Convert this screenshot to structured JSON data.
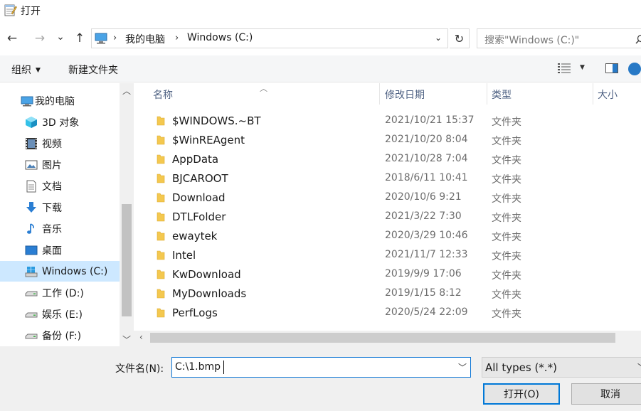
{
  "window": {
    "title": "打开"
  },
  "nav_buttons": {
    "back": "←",
    "forward": "→",
    "recent": "⌄",
    "up": "↑"
  },
  "address": {
    "crumbs": [
      "我的电脑",
      "Windows (C:)"
    ],
    "separator": "›",
    "dropdown": "⌄",
    "refresh": "↻"
  },
  "search": {
    "placeholder": "搜索\"Windows (C:)\""
  },
  "toolbar": {
    "organize": "组织",
    "new_folder": "新建文件夹"
  },
  "sidebar": {
    "items": [
      {
        "label": "我的电脑",
        "icon": "computer-icon"
      },
      {
        "label": "3D 对象",
        "icon": "3d-objects-icon"
      },
      {
        "label": "视频",
        "icon": "video-icon"
      },
      {
        "label": "图片",
        "icon": "pictures-icon"
      },
      {
        "label": "文档",
        "icon": "documents-icon"
      },
      {
        "label": "下载",
        "icon": "download-icon"
      },
      {
        "label": "音乐",
        "icon": "music-icon"
      },
      {
        "label": "桌面",
        "icon": "desktop-icon"
      },
      {
        "label": "Windows (C:)",
        "icon": "system-drive-icon",
        "selected": true
      },
      {
        "label": "工作 (D:)",
        "icon": "drive-icon"
      },
      {
        "label": "娱乐 (E:)",
        "icon": "drive-icon"
      },
      {
        "label": "备份 (F:)",
        "icon": "drive-icon"
      }
    ]
  },
  "file_list": {
    "columns": [
      "名称",
      "修改日期",
      "类型",
      "大小"
    ],
    "rows": [
      {
        "name": "$WINDOWS.~BT",
        "date": "2021/10/21 15:37",
        "type": "文件夹"
      },
      {
        "name": "$WinREAgent",
        "date": "2021/10/20 8:04",
        "type": "文件夹"
      },
      {
        "name": "AppData",
        "date": "2021/10/28 7:04",
        "type": "文件夹"
      },
      {
        "name": "BJCAROOT",
        "date": "2018/6/11 10:41",
        "type": "文件夹"
      },
      {
        "name": "Download",
        "date": "2020/10/6 9:21",
        "type": "文件夹"
      },
      {
        "name": "DTLFolder",
        "date": "2021/3/22 7:30",
        "type": "文件夹"
      },
      {
        "name": "ewaytek",
        "date": "2020/3/29 10:46",
        "type": "文件夹"
      },
      {
        "name": "Intel",
        "date": "2021/11/7 12:33",
        "type": "文件夹"
      },
      {
        "name": "KwDownload",
        "date": "2019/9/9 17:06",
        "type": "文件夹"
      },
      {
        "name": "MyDownloads",
        "date": "2019/1/15 8:12",
        "type": "文件夹"
      },
      {
        "name": "PerfLogs",
        "date": "2020/5/24 22:09",
        "type": "文件夹"
      }
    ]
  },
  "bottom": {
    "filename_label": "文件名(N):",
    "filename_value": "C:\\1.bmp",
    "file_type": "All types (*.*)",
    "open_label": "打开(O)",
    "cancel_label": "取消"
  },
  "colors": {
    "selection": "#cde8ff",
    "accent": "#0078d7",
    "folder": "#f4c84f",
    "header_text": "#4d6082"
  }
}
